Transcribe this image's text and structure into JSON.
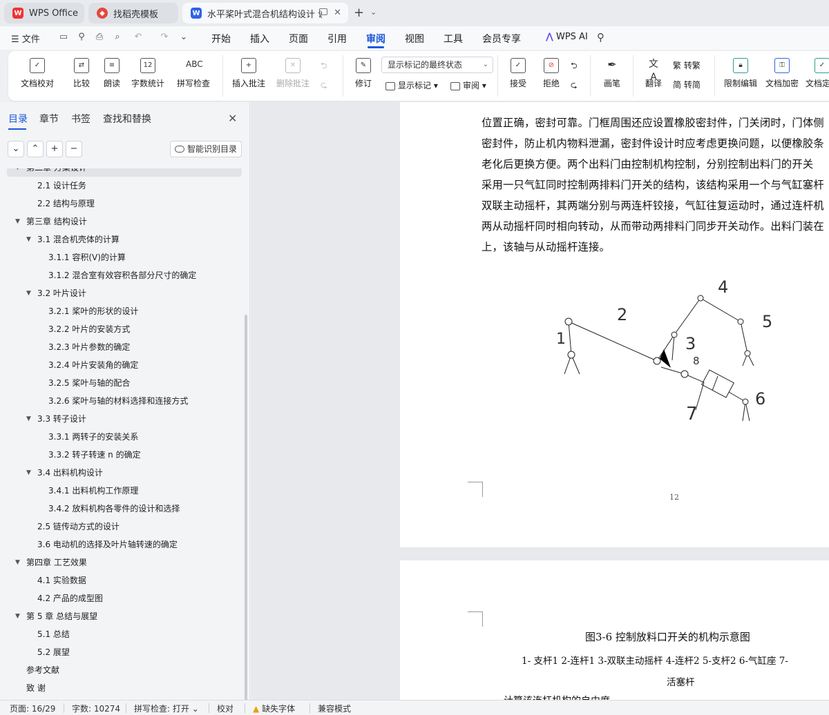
{
  "tabs": [
    {
      "label": "WPS Office"
    },
    {
      "label": "找稻壳模板"
    },
    {
      "label": "水平桨叶式混合机结构设计 说"
    }
  ],
  "menu": {
    "file": "文件",
    "items": [
      "开始",
      "插入",
      "页面",
      "引用",
      "审阅",
      "视图",
      "工具",
      "会员专享"
    ],
    "active": "审阅",
    "wps_ai": "WPS AI"
  },
  "ribbon": {
    "doc_check": "文档校对",
    "compare": "比较",
    "read_aloud": "朗读",
    "word_count": "字数统计",
    "spell_check": "拼写检查",
    "insert_comment": "插入批注",
    "delete_comment": "删除批注",
    "revise": "修订",
    "markup_select": "显示标记的最终状态",
    "show_markup": "显示标记",
    "review": "审阅",
    "accept": "接受",
    "reject": "拒绝",
    "pen": "画笔",
    "translate": "翻译",
    "simp_to_trad": "转繁",
    "trad_to_simp": "转简",
    "restrict_edit": "限制编辑",
    "encrypt": "文档加密",
    "finalize": "文档定稿",
    "word_count_icon_text": "12",
    "spell_icon_text": "ABC"
  },
  "sidebar": {
    "tabs": [
      "目录",
      "章节",
      "书签",
      "查找和替换"
    ],
    "active_tab": "目录",
    "smart_btn": "智能识别目录",
    "toc": [
      {
        "text": "第二章 方案设计",
        "level": 1,
        "expanded": true
      },
      {
        "text": "2.1 设计任务",
        "level": 2
      },
      {
        "text": "2.2 结构与原理",
        "level": 2
      },
      {
        "text": "第三章  结构设计",
        "level": 1,
        "expanded": true
      },
      {
        "text": "3.1 混合机壳体的计算",
        "level": 2,
        "expanded": true
      },
      {
        "text": "3.1.1  容积(V)的计算",
        "level": 3
      },
      {
        "text": "3.1.2  混合室有效容积各部分尺寸的确定",
        "level": 3
      },
      {
        "text": "3.2 叶片设计",
        "level": 2,
        "expanded": true
      },
      {
        "text": "3.2.1 桨叶的形状的设计",
        "level": 3
      },
      {
        "text": "3.2.2  叶片的安装方式",
        "level": 3
      },
      {
        "text": "3.2.3  叶片参数的确定",
        "level": 3
      },
      {
        "text": "3.2.4  叶片安装角的确定",
        "level": 3
      },
      {
        "text": "3.2.5  桨叶与轴的配合",
        "level": 3
      },
      {
        "text": "3.2.6 桨叶与轴的材料选择和连接方式",
        "level": 3
      },
      {
        "text": "3.3  转子设计",
        "level": 2,
        "expanded": true
      },
      {
        "text": "3.3.1  两转子的安装关系",
        "level": 3
      },
      {
        "text": "3.3.2  转子转速 n 的确定",
        "level": 3
      },
      {
        "text": "3.4  出料机构设计",
        "level": 2,
        "expanded": true
      },
      {
        "text": "3.4.1 出料机构工作原理",
        "level": 3
      },
      {
        "text": "3.4.2  放料机构各零件的设计和选择",
        "level": 3
      },
      {
        "text": "2.5 链传动方式的设计",
        "level": 2
      },
      {
        "text": "3.6 电动机的选择及叶片轴转速的确定",
        "level": 2
      },
      {
        "text": "第四章  工艺效果",
        "level": 1,
        "expanded": true
      },
      {
        "text": "4.1 实验数据",
        "level": 2
      },
      {
        "text": "4.2 产品的成型图",
        "level": 2
      },
      {
        "text": "第 5 章  总结与展望",
        "level": 1,
        "expanded": true
      },
      {
        "text": "5.1  总结",
        "level": 2
      },
      {
        "text": "5.2  展望",
        "level": 2
      },
      {
        "text": "参考文献",
        "level": 1
      },
      {
        "text": "致   谢",
        "level": 1
      }
    ]
  },
  "document": {
    "page1_lines": [
      "位置正确，密封可靠。门框周围还应设置橡胶密封件，门关闭时，门体侧",
      "密封件，防止机内物料泄漏，密封件设计时应考虑更换问题，以便橡胶条",
      "老化后更换方便。两个出料门由控制机构控制，分别控制出料门的开关",
      "采用一只气缸同时控制两排料门开关的结构，该结构采用一个与气缸塞杆",
      "双联主动摇杆，其两端分别与两连杆铰接，气缸往复运动时，通过连杆机",
      "两从动摇杆同时相向转动，从而带动两排料门同步开关动作。出料门装在",
      "上，该轴与从动摇杆连接。"
    ],
    "figure_labels": [
      "1",
      "2",
      "3",
      "4",
      "5",
      "6",
      "7",
      "8"
    ],
    "page_number": "12",
    "caption": "图3-6  控制放料口开关的机构示意图",
    "legend_line1": "1-     支杆1   2-连杆1   3-双联主动摇杆  4-连杆2    5-支杆2   6-气缸座   7-",
    "legend_line2": "活塞杆",
    "next_line": "计算该连杆机构的自由度"
  },
  "status": {
    "page": "页面: 16/29",
    "words": "字数: 10274",
    "spell": "拼写检查: 打开",
    "proof": "校对",
    "missing_font": "缺失字体",
    "compat": "兼容模式"
  }
}
